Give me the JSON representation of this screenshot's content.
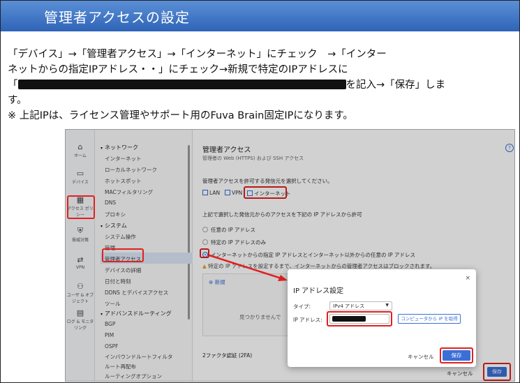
{
  "page": {
    "title": "管理者アクセスの設定",
    "instructions": [
      "「デバイス」→「管理者アクセス」→「インターネット」にチェック　→「インター",
      "ネットからの指定IPアドレス・・」にチェック→新規で特定のIPアドレスに",
      "を記入→「保存」しま",
      "す。",
      "※ 上記IPは、ライセンス管理やサポート用のFuva Brain固定IPになります。"
    ],
    "line3_prefix": "「"
  },
  "screenshot": {
    "iconbar": [
      {
        "icon": "home-icon",
        "glyph": "⌂",
        "label": "ホーム"
      },
      {
        "icon": "device-icon",
        "glyph": "▭",
        "label": "デバイス"
      },
      {
        "icon": "access-policy-icon",
        "glyph": "▦",
        "label": "アクセス ポリシー"
      },
      {
        "icon": "threat-icon",
        "glyph": "⛨",
        "label": "脅威対策"
      },
      {
        "icon": "vpn-icon",
        "glyph": "⇄",
        "label": "VPN"
      },
      {
        "icon": "user-object-icon",
        "glyph": "⚇",
        "label": "ユーザ & オブジェクト"
      },
      {
        "icon": "log-monitor-icon",
        "glyph": "▤",
        "label": "ログ & モニタリング"
      }
    ],
    "menu": {
      "network": {
        "header": "ネットワーク",
        "items": [
          "インターネット",
          "ローカルネットワーク",
          "ホットスポット",
          "MACフィルタリング",
          "DNS",
          "プロキシ"
        ]
      },
      "system": {
        "header": "システム",
        "items": [
          "システム操作",
          "管理",
          "管理者アクセス",
          "デバイスの詳細",
          "日付と時刻",
          "DDNS とデバイスアクセス",
          "ツール"
        ]
      },
      "routing": {
        "header": "アドバンスドルーティング",
        "items": [
          "BGP",
          "PIM",
          "OSPF",
          "インバウンドルートフィルタ",
          "ルート再配布",
          "ルーティングオプション"
        ]
      }
    },
    "content": {
      "title": "管理者アクセス",
      "subtitle": "管理者の Web (HTTPS) および SSH アクセス",
      "source_prompt": "管理者アクセスを許可する発信元を選択してください。",
      "checkboxes": [
        "LAN",
        "VPN",
        "インターネット"
      ],
      "allow_prompt": "上記で選択した発信元からのアクセスを下記の IP アドレスから許可",
      "radios": [
        "任意の IP アドレス",
        "特定の IP アドレスのみ",
        "インターネットからの指定 IP アドレスとインターネット以外からの任意の IP アドレス"
      ],
      "warning": "特定の IP アドレスを設定するまで、インターネットからの管理者アクセスはブロックされます。",
      "new_label": "新規",
      "empty_text": "見つかりませんで",
      "twofa": "2ファクタ認証 (2FA)",
      "cancel": "キャンセル",
      "save": "保存"
    },
    "dialog": {
      "title": "IP アドレス設定",
      "close": "×",
      "type_label": "タイプ:",
      "type_value": "IPv4 アドレス",
      "ip_label": "IP アドレス:",
      "computer_ip_button": "コンピュータから IP を取得",
      "cancel": "キャンセル",
      "save": "保存"
    }
  }
}
